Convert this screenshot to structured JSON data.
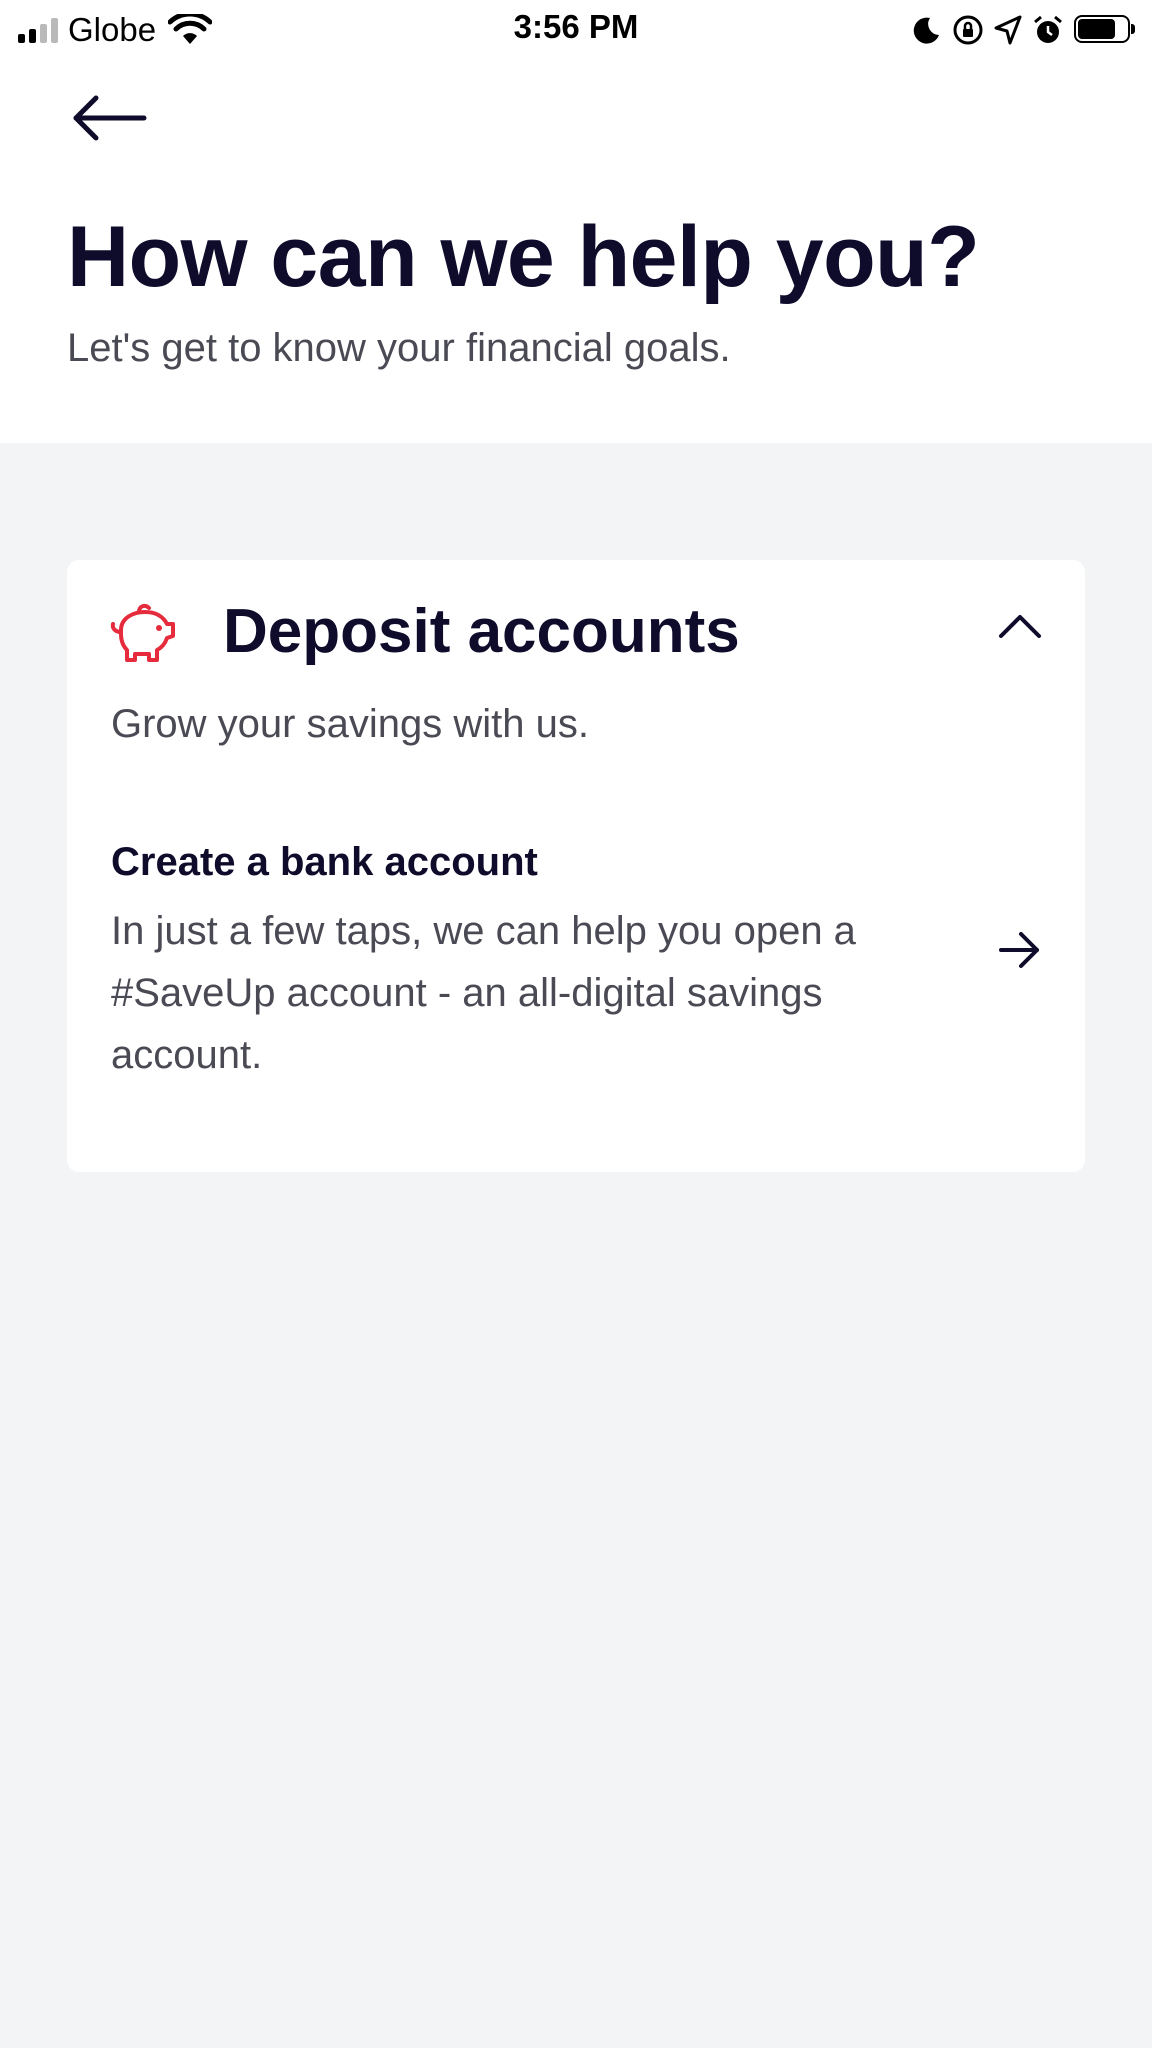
{
  "status_bar": {
    "carrier": "Globe",
    "time": "3:56 PM",
    "icons": [
      "signal-icon",
      "wifi-icon",
      "moon-icon",
      "rotation-lock-icon",
      "location-icon",
      "alarm-icon",
      "battery-icon"
    ]
  },
  "header": {
    "back_icon": "arrow-left-icon",
    "title": "How can we help you?",
    "subtitle": "Let's get to know your financial goals."
  },
  "card": {
    "icon": "piggy-bank-icon",
    "title": "Deposit accounts",
    "subtitle": "Grow your savings with us.",
    "expanded": true,
    "options": [
      {
        "title": "Create a bank account",
        "description": "In just a few taps, we can help you open a #SaveUp account - an all-digital savings account.",
        "icon": "arrow-right-icon"
      }
    ]
  },
  "colors": {
    "accent": "#e52b3c",
    "text_primary": "#0e0b2b",
    "text_secondary": "#4a4a55",
    "background": "#f3f4f6",
    "surface": "#ffffff"
  }
}
